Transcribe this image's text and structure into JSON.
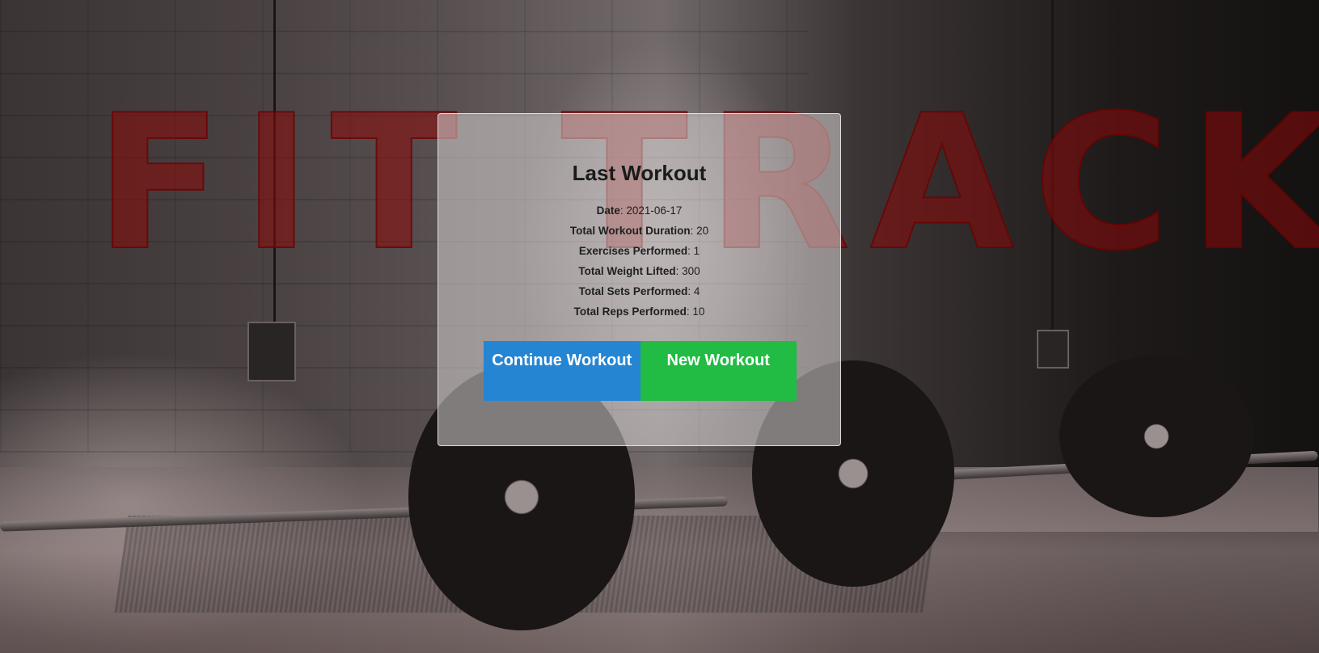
{
  "brand": {
    "title": "FIT TRACK"
  },
  "last_workout": {
    "title": "Last Workout",
    "stats": [
      {
        "label": "Date",
        "value": "2021-06-17"
      },
      {
        "label": "Total Workout Duration",
        "value": "20"
      },
      {
        "label": "Exercises Performed",
        "value": "1"
      },
      {
        "label": "Total Weight Lifted",
        "value": "300"
      },
      {
        "label": "Total Sets Performed",
        "value": "4"
      },
      {
        "label": "Total Reps Performed",
        "value": "10"
      }
    ]
  },
  "buttons": {
    "continue_label": "Continue Workout",
    "new_label": "New Workout"
  },
  "colors": {
    "continue_button": "#2585d3",
    "new_button": "#22bb44",
    "brand_text": "#8c0a0a"
  }
}
